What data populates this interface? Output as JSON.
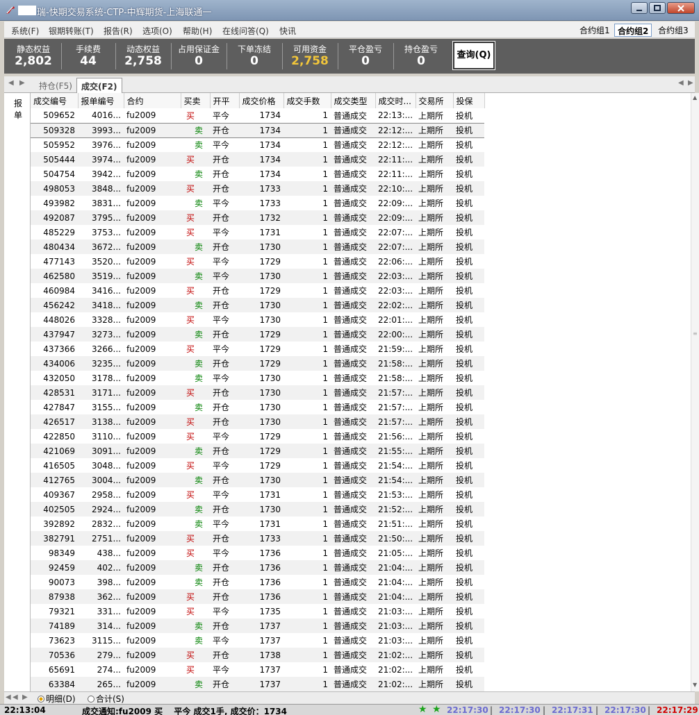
{
  "window": {
    "title": "瑞-快期交易系统-CTP-中辉期货-上海联通一"
  },
  "menu": [
    "系统(F)",
    "银期转账(T)",
    "报告(R)",
    "选项(O)",
    "帮助(H)",
    "在线问答(Q)",
    "快讯"
  ],
  "contract_groups": [
    "合约组1",
    "合约组2",
    "合约组3"
  ],
  "stats": [
    {
      "label": "静态权益",
      "value": "2,802"
    },
    {
      "label": "手续费",
      "value": "44"
    },
    {
      "label": "动态权益",
      "value": "2,758"
    },
    {
      "label": "占用保证金",
      "value": "0"
    },
    {
      "label": "下单冻结",
      "value": "0"
    },
    {
      "label": "可用资金",
      "value": "2,758"
    },
    {
      "label": "平仓盈亏",
      "value": "0"
    },
    {
      "label": "持仓盈亏",
      "value": "0"
    }
  ],
  "query_button": "查询(Q)",
  "tabs": [
    "持仓(F5)",
    "成交(F2)"
  ],
  "left_header": "报单",
  "columns": [
    "成交编号",
    "报单编号",
    "合约",
    "买卖",
    "开平",
    "成交价格",
    "成交手数",
    "成交类型",
    "成交时...",
    "交易所",
    "投保"
  ],
  "rows": [
    [
      "509652",
      "4016...",
      "fu2009",
      "买",
      "平今",
      "1734",
      "1",
      "普通成交",
      "22:13:...",
      "上期所",
      "投机"
    ],
    [
      "509328",
      "3993...",
      "fu2009",
      "卖",
      "开仓",
      "1734",
      "1",
      "普通成交",
      "22:12:...",
      "上期所",
      "投机"
    ],
    [
      "505952",
      "3976...",
      "fu2009",
      "卖",
      "平今",
      "1734",
      "1",
      "普通成交",
      "22:12:...",
      "上期所",
      "投机"
    ],
    [
      "505444",
      "3974...",
      "fu2009",
      "买",
      "开仓",
      "1734",
      "1",
      "普通成交",
      "22:11:...",
      "上期所",
      "投机"
    ],
    [
      "504754",
      "3942...",
      "fu2009",
      "卖",
      "开仓",
      "1734",
      "1",
      "普通成交",
      "22:11:...",
      "上期所",
      "投机"
    ],
    [
      "498053",
      "3848...",
      "fu2009",
      "买",
      "开仓",
      "1733",
      "1",
      "普通成交",
      "22:10:...",
      "上期所",
      "投机"
    ],
    [
      "493982",
      "3831...",
      "fu2009",
      "卖",
      "平今",
      "1733",
      "1",
      "普通成交",
      "22:09:...",
      "上期所",
      "投机"
    ],
    [
      "492087",
      "3795...",
      "fu2009",
      "买",
      "开仓",
      "1732",
      "1",
      "普通成交",
      "22:09:...",
      "上期所",
      "投机"
    ],
    [
      "485229",
      "3753...",
      "fu2009",
      "买",
      "平今",
      "1731",
      "1",
      "普通成交",
      "22:07:...",
      "上期所",
      "投机"
    ],
    [
      "480434",
      "3672...",
      "fu2009",
      "卖",
      "开仓",
      "1730",
      "1",
      "普通成交",
      "22:07:...",
      "上期所",
      "投机"
    ],
    [
      "477143",
      "3520...",
      "fu2009",
      "买",
      "平今",
      "1729",
      "1",
      "普通成交",
      "22:06:...",
      "上期所",
      "投机"
    ],
    [
      "462580",
      "3519...",
      "fu2009",
      "卖",
      "平今",
      "1730",
      "1",
      "普通成交",
      "22:03:...",
      "上期所",
      "投机"
    ],
    [
      "460984",
      "3416...",
      "fu2009",
      "买",
      "开仓",
      "1729",
      "1",
      "普通成交",
      "22:03:...",
      "上期所",
      "投机"
    ],
    [
      "456242",
      "3418...",
      "fu2009",
      "卖",
      "开仓",
      "1730",
      "1",
      "普通成交",
      "22:02:...",
      "上期所",
      "投机"
    ],
    [
      "448026",
      "3328...",
      "fu2009",
      "买",
      "平今",
      "1730",
      "1",
      "普通成交",
      "22:01:...",
      "上期所",
      "投机"
    ],
    [
      "437947",
      "3273...",
      "fu2009",
      "卖",
      "开仓",
      "1729",
      "1",
      "普通成交",
      "22:00:...",
      "上期所",
      "投机"
    ],
    [
      "437366",
      "3266...",
      "fu2009",
      "买",
      "平今",
      "1729",
      "1",
      "普通成交",
      "21:59:...",
      "上期所",
      "投机"
    ],
    [
      "434006",
      "3235...",
      "fu2009",
      "卖",
      "开仓",
      "1729",
      "1",
      "普通成交",
      "21:58:...",
      "上期所",
      "投机"
    ],
    [
      "432050",
      "3178...",
      "fu2009",
      "卖",
      "平今",
      "1730",
      "1",
      "普通成交",
      "21:58:...",
      "上期所",
      "投机"
    ],
    [
      "428531",
      "3171...",
      "fu2009",
      "买",
      "开仓",
      "1730",
      "1",
      "普通成交",
      "21:57:...",
      "上期所",
      "投机"
    ],
    [
      "427847",
      "3155...",
      "fu2009",
      "卖",
      "开仓",
      "1730",
      "1",
      "普通成交",
      "21:57:...",
      "上期所",
      "投机"
    ],
    [
      "426517",
      "3138...",
      "fu2009",
      "买",
      "开仓",
      "1730",
      "1",
      "普通成交",
      "21:57:...",
      "上期所",
      "投机"
    ],
    [
      "422850",
      "3110...",
      "fu2009",
      "买",
      "平今",
      "1729",
      "1",
      "普通成交",
      "21:56:...",
      "上期所",
      "投机"
    ],
    [
      "421069",
      "3091...",
      "fu2009",
      "卖",
      "开仓",
      "1729",
      "1",
      "普通成交",
      "21:55:...",
      "上期所",
      "投机"
    ],
    [
      "416505",
      "3048...",
      "fu2009",
      "买",
      "平今",
      "1729",
      "1",
      "普通成交",
      "21:54:...",
      "上期所",
      "投机"
    ],
    [
      "412765",
      "3004...",
      "fu2009",
      "卖",
      "开仓",
      "1730",
      "1",
      "普通成交",
      "21:54:...",
      "上期所",
      "投机"
    ],
    [
      "409367",
      "2958...",
      "fu2009",
      "买",
      "平今",
      "1731",
      "1",
      "普通成交",
      "21:53:...",
      "上期所",
      "投机"
    ],
    [
      "402505",
      "2924...",
      "fu2009",
      "卖",
      "开仓",
      "1730",
      "1",
      "普通成交",
      "21:52:...",
      "上期所",
      "投机"
    ],
    [
      "392892",
      "2832...",
      "fu2009",
      "卖",
      "平今",
      "1731",
      "1",
      "普通成交",
      "21:51:...",
      "上期所",
      "投机"
    ],
    [
      "382791",
      "2751...",
      "fu2009",
      "买",
      "开仓",
      "1733",
      "1",
      "普通成交",
      "21:50:...",
      "上期所",
      "投机"
    ],
    [
      "98349",
      "438...",
      "fu2009",
      "买",
      "平今",
      "1736",
      "1",
      "普通成交",
      "21:05:...",
      "上期所",
      "投机"
    ],
    [
      "92459",
      "402...",
      "fu2009",
      "卖",
      "开仓",
      "1736",
      "1",
      "普通成交",
      "21:04:...",
      "上期所",
      "投机"
    ],
    [
      "90073",
      "398...",
      "fu2009",
      "卖",
      "开仓",
      "1736",
      "1",
      "普通成交",
      "21:04:...",
      "上期所",
      "投机"
    ],
    [
      "87938",
      "362...",
      "fu2009",
      "买",
      "开仓",
      "1736",
      "1",
      "普通成交",
      "21:04:...",
      "上期所",
      "投机"
    ],
    [
      "79321",
      "331...",
      "fu2009",
      "买",
      "平今",
      "1735",
      "1",
      "普通成交",
      "21:03:...",
      "上期所",
      "投机"
    ],
    [
      "74189",
      "314...",
      "fu2009",
      "卖",
      "开仓",
      "1737",
      "1",
      "普通成交",
      "21:03:...",
      "上期所",
      "投机"
    ],
    [
      "73623",
      "3115...",
      "fu2009",
      "卖",
      "平今",
      "1737",
      "1",
      "普通成交",
      "21:03:...",
      "上期所",
      "投机"
    ],
    [
      "70536",
      "279...",
      "fu2009",
      "买",
      "开仓",
      "1738",
      "1",
      "普通成交",
      "21:02:...",
      "上期所",
      "投机"
    ],
    [
      "65691",
      "274...",
      "fu2009",
      "买",
      "平今",
      "1737",
      "1",
      "普通成交",
      "21:02:...",
      "上期所",
      "投机"
    ],
    [
      "63384",
      "265...",
      "fu2009",
      "卖",
      "开仓",
      "1737",
      "1",
      "普通成交",
      "21:02:...",
      "上期所",
      "投机"
    ]
  ],
  "bottom_options": [
    "明细(D)",
    "合计(S)"
  ],
  "status": {
    "time": "22:13:04",
    "notice": "成交通知:fu2009 买　 平今 成交1手, 成交价：1734",
    "clocks": [
      "22:17:30",
      "22:17:30",
      "22:17:31",
      "22:17:30",
      "22:17:29"
    ]
  },
  "colors": {
    "buy": "#c00000",
    "sell": "#008000",
    "gold": "#f2c63a"
  }
}
